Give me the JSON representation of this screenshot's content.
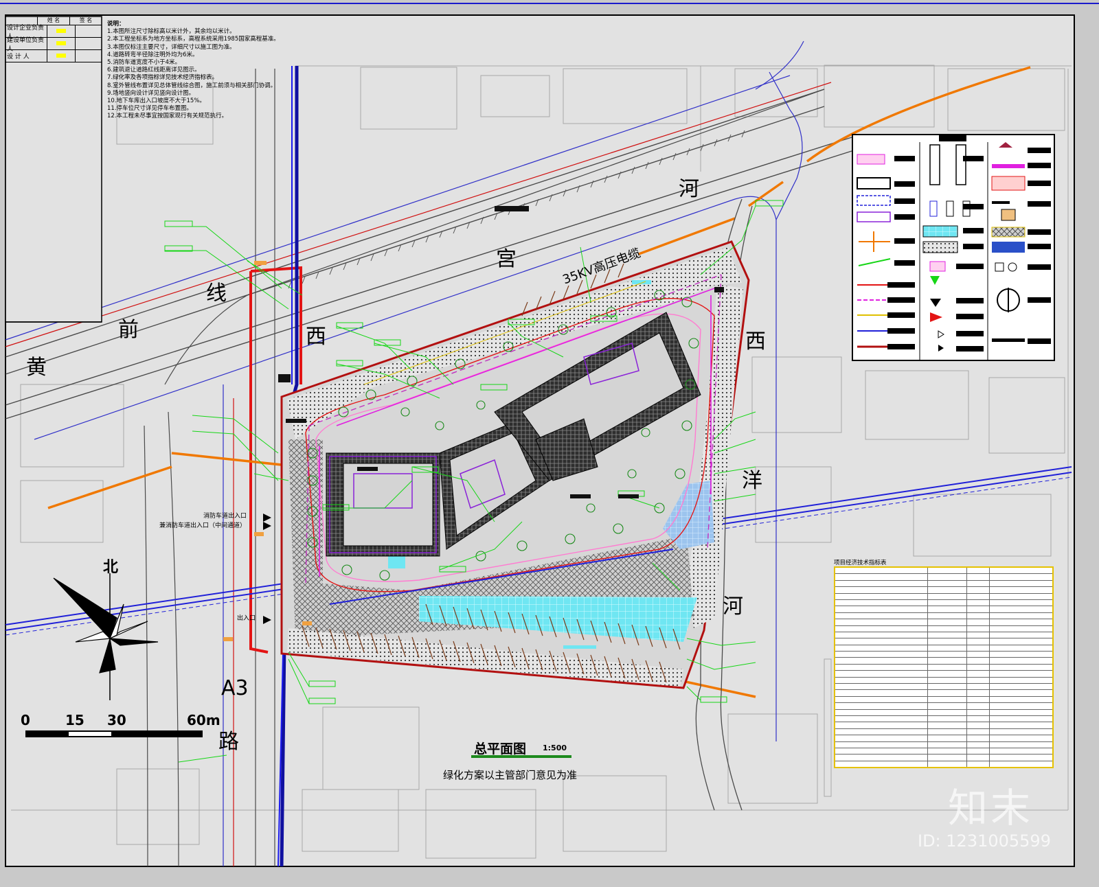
{
  "colors": {
    "paper": "#e2e2e2",
    "building": "#3a3a3a",
    "green": "#16d616",
    "red": "#e31414",
    "blue": "#2020c8",
    "orange": "#f07800",
    "cyan": "#5fe6f0",
    "magenta": "#e020e0"
  },
  "title_block": {
    "headers": [
      "姓 名",
      "签 名"
    ],
    "rows": [
      {
        "label": "设计企业负责人"
      },
      {
        "label": "建设单位负责人"
      },
      {
        "label": "设 计 人"
      }
    ]
  },
  "notes": {
    "heading": "说明：",
    "lines": [
      "1.本图所注尺寸除标高以米计外，其余均以米计。",
      "2.本工程坐标系为地方坐标系，高程系统采用1985国家高程基准。",
      "3.本图仅标注主要尺寸，详细尺寸以施工图为准。",
      "4.道路转弯半径除注明外均为6米。",
      "5.消防车道宽度不小于4米。",
      "6.建筑退让道路红线距离详见图示。",
      "7.绿化率及各项指标详见技术经济指标表。",
      "8.室外管线布置详见总体管线综合图，施工前须与相关部门协调。",
      "9.场地竖向设计详见竖向设计图。",
      "10.地下车库出入口坡度不大于15%。",
      "11.停车位尺寸详见停车布置图。",
      "12.本工程未尽事宜按国家现行有关规范执行。"
    ]
  },
  "map_labels": {
    "road_lines": [
      {
        "text": "黄"
      },
      {
        "text": "前"
      },
      {
        "text": "线"
      },
      {
        "text": "西"
      },
      {
        "text": "宫"
      },
      {
        "text": "河"
      },
      {
        "text": "西"
      },
      {
        "text": "洋"
      },
      {
        "text": "河"
      },
      {
        "text": "A3"
      },
      {
        "text": "路"
      }
    ],
    "cable": "35KV高压电缆",
    "entry_1": "消防车道出入口",
    "entry_2": "兼消防车道出入口（中间通道）",
    "entry_3": "出入口"
  },
  "scale_bar": {
    "ticks": [
      "0",
      "15",
      "30",
      "60m"
    ]
  },
  "north": "北",
  "plan_title": "总平面图",
  "plan_scale": "1:500",
  "plan_note": "绿化方案以主管部门意见为准",
  "table": {
    "title": "项目经济技术指标表"
  },
  "watermark": {
    "logo": "知末",
    "id": "ID: 1231005599"
  }
}
